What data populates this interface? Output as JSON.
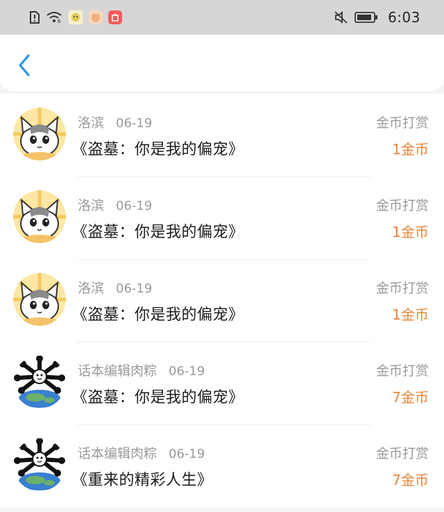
{
  "status_bar": {
    "time": "6:03",
    "icons": [
      "sim-alert-icon",
      "wifi-icon",
      "app-icon-1",
      "app-icon-2",
      "app-icon-3",
      "mute-icon",
      "battery-icon"
    ]
  },
  "header": {
    "back_icon": "chevron-left-icon",
    "accent": "#2b93e6"
  },
  "colors": {
    "reward_amount": "#e8843a",
    "muted_text": "#9a9a9a"
  },
  "records": [
    {
      "author": "洛滨",
      "date": "06-19",
      "book": "《盗墓：你是我的偏宠》",
      "reward_type": "金币打赏",
      "amount": "1金币",
      "avatar": "cat"
    },
    {
      "author": "洛滨",
      "date": "06-19",
      "book": "《盗墓：你是我的偏宠》",
      "reward_type": "金币打赏",
      "amount": "1金币",
      "avatar": "cat"
    },
    {
      "author": "洛滨",
      "date": "06-19",
      "book": "《盗墓：你是我的偏宠》",
      "reward_type": "金币打赏",
      "amount": "1金币",
      "avatar": "cat"
    },
    {
      "author": "话本编辑肉粽",
      "date": "06-19",
      "book": "《盗墓：你是我的偏宠》",
      "reward_type": "金币打赏",
      "amount": "7金币",
      "avatar": "globe"
    },
    {
      "author": "话本编辑肉粽",
      "date": "06-19",
      "book": "《重来的精彩人生》",
      "reward_type": "金币打赏",
      "amount": "7金币",
      "avatar": "globe"
    }
  ]
}
